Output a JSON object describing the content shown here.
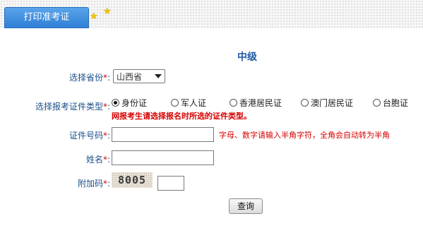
{
  "header": {
    "tab_label": "打印准考证"
  },
  "form": {
    "level": "中级",
    "required_mark": "*",
    "province": {
      "label": "选择省份",
      "value": "山西省"
    },
    "id_type": {
      "label": "选择报考证件类型",
      "options": [
        "身份证",
        "军人证",
        "香港居民证",
        "澳门居民证",
        "台胞证"
      ],
      "selected": "身份证",
      "warning": "网报考生请选择报名时所选的证件类型。"
    },
    "id_number": {
      "label": "证件号码",
      "value": "",
      "hint": "字母、数字请输入半角字符，全角会自动转为半角"
    },
    "name": {
      "label": "姓名",
      "value": ""
    },
    "captcha": {
      "label": "附加码",
      "image_text": "8005",
      "value": ""
    },
    "submit_label": "查询"
  }
}
